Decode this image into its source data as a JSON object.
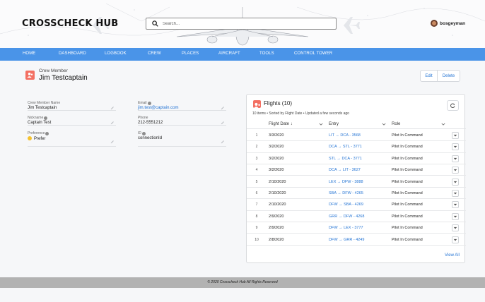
{
  "header": {
    "logo": "CROSSCHECK HUB",
    "search_placeholder": "Search...",
    "username": "bosgeyman"
  },
  "nav": {
    "items": [
      "HOME",
      "DASHBOARD",
      "LOGBOOK",
      "CREW",
      "PLACES",
      "AIRCRAFT",
      "TOOLS",
      "CONTROL TOWER"
    ]
  },
  "record": {
    "type_label": "Crew Member",
    "name": "Jim Testcaptain",
    "edit_label": "Edit",
    "delete_label": "Delete"
  },
  "details": {
    "crew_member_name_label": "Crew Member Name",
    "crew_member_name": "Jim Testcaptain",
    "nickname_label": "Nickname",
    "nickname": "Captain Test",
    "preference_label": "Preference",
    "preference": "Prefer",
    "email_label": "Email",
    "email": "jim.test@captain.com",
    "phone_label": "Phone",
    "phone": "212-5551212",
    "id_label": "ID",
    "id": "connectionId"
  },
  "flights": {
    "title": "Flights (10)",
    "subtitle": "10 items • Sorted by Flight Date • Updated a few seconds ago",
    "columns": {
      "date": "Flight Date",
      "entry": "Entry",
      "role": "Role"
    },
    "rows": [
      {
        "num": "1",
        "date": "3/3/2020",
        "entry": "LIT → DCA - 3568",
        "role": "Pilot In Command"
      },
      {
        "num": "2",
        "date": "3/2/2020",
        "entry": "DCA → STL - 3771",
        "role": "Pilot In Command"
      },
      {
        "num": "3",
        "date": "3/2/2020",
        "entry": "STL → DCA - 3771",
        "role": "Pilot In Command"
      },
      {
        "num": "4",
        "date": "3/2/2020",
        "entry": "DCA → LIT - 3627",
        "role": "Pilot In Command"
      },
      {
        "num": "5",
        "date": "2/10/2020",
        "entry": "LEX → DFW - 3888",
        "role": "Pilot In Command"
      },
      {
        "num": "6",
        "date": "2/10/2020",
        "entry": "SBA → DFW - 4265",
        "role": "Pilot In Command"
      },
      {
        "num": "7",
        "date": "2/10/2020",
        "entry": "DFW → SBA - 4269",
        "role": "Pilot In Command"
      },
      {
        "num": "8",
        "date": "2/9/2020",
        "entry": "GRR → DFW - 4268",
        "role": "Pilot In Command"
      },
      {
        "num": "9",
        "date": "2/9/2020",
        "entry": "DFW → LEX - 3777",
        "role": "Pilot In Command"
      },
      {
        "num": "10",
        "date": "2/8/2020",
        "entry": "DFW → GRR - 4249",
        "role": "Pilot In Command"
      }
    ],
    "view_all_label": "View All"
  },
  "footer": {
    "text": "© 2020 Crosscheck Hub All Rights Reserved"
  },
  "colors": {
    "nav": "#4a94e8",
    "link": "#2474d4",
    "accent_icon": "#f36f62",
    "footer": "#b2b2b2"
  },
  "icons": [
    "search-icon",
    "crew-member-icon",
    "pencil-icon",
    "info-icon",
    "refresh-icon",
    "chevron-down-icon",
    "sort-down-arrow-icon",
    "user-avatar",
    "airplane-icon"
  ]
}
